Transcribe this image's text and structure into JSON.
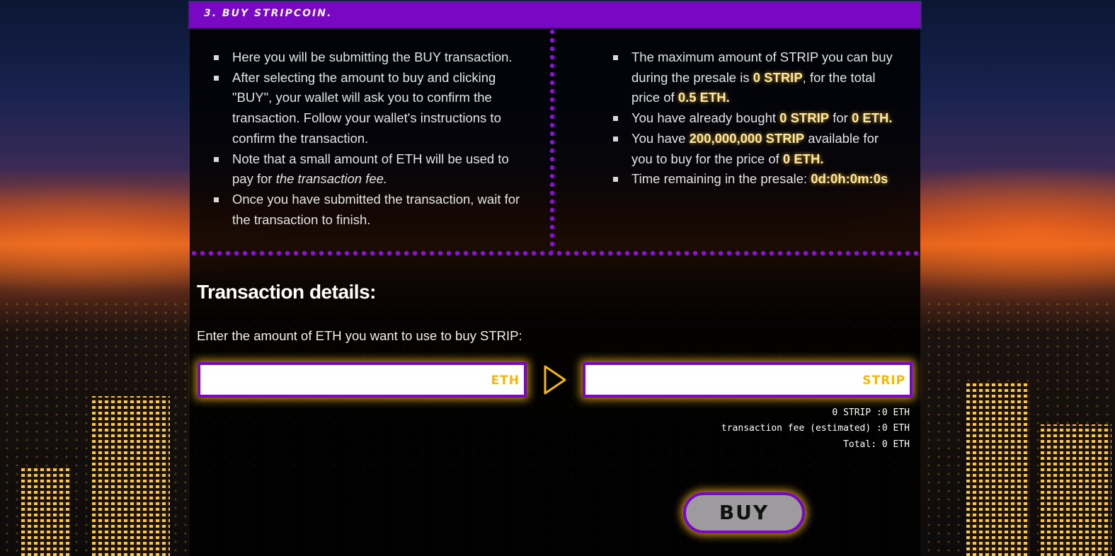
{
  "header": {
    "title": "3. BUY STRIPCOIN."
  },
  "instructions": {
    "items": [
      "Here you will be submitting the BUY transaction.",
      "After selecting the amount to buy and clicking \"BUY\", your wallet will ask you to confirm the transaction. Follow your wallet's instructions to confirm the transaction.",
      {
        "pre": "Note that a small amount of ETH will be used to pay for ",
        "em": "the transaction fee."
      },
      "Once you have submitted the transaction, wait for the transaction to finish."
    ]
  },
  "presale": {
    "max_pre": "The maximum amount of STRIP you can buy during the presale is ",
    "max_strip": "0 STRIP",
    "max_mid": ", for the total price of ",
    "max_eth": "0.5 ETH.",
    "bought_pre": "You have already bought ",
    "bought_strip": "0 STRIP",
    "bought_mid": " for ",
    "bought_eth": "0 ETH.",
    "avail_pre": "You have ",
    "avail_strip": "200,000,000 STRIP",
    "avail_mid": " available for you to buy for the price of ",
    "avail_eth": "0 ETH.",
    "time_pre": "Time remaining in the presale: ",
    "time_value": "0d:0h:0m:0s"
  },
  "transaction": {
    "title": "Transaction details:",
    "instruction": "Enter the amount of ETH you want to use to buy STRIP:",
    "eth_unit": "ETH",
    "strip_unit": "STRIP",
    "eth_value": "",
    "strip_value": "",
    "summary_line1": "0 STRIP :0 ETH",
    "summary_line2": "transaction fee (estimated) :0 ETH",
    "summary_line3": "Total: 0 ETH"
  },
  "buy_button": {
    "label": "BUY"
  },
  "colors": {
    "purple": "#7a07c4",
    "gold": "#f5b60f",
    "highlight": "#ffe8a0"
  },
  "icons": {
    "arrow": "play-triangle-icon"
  }
}
